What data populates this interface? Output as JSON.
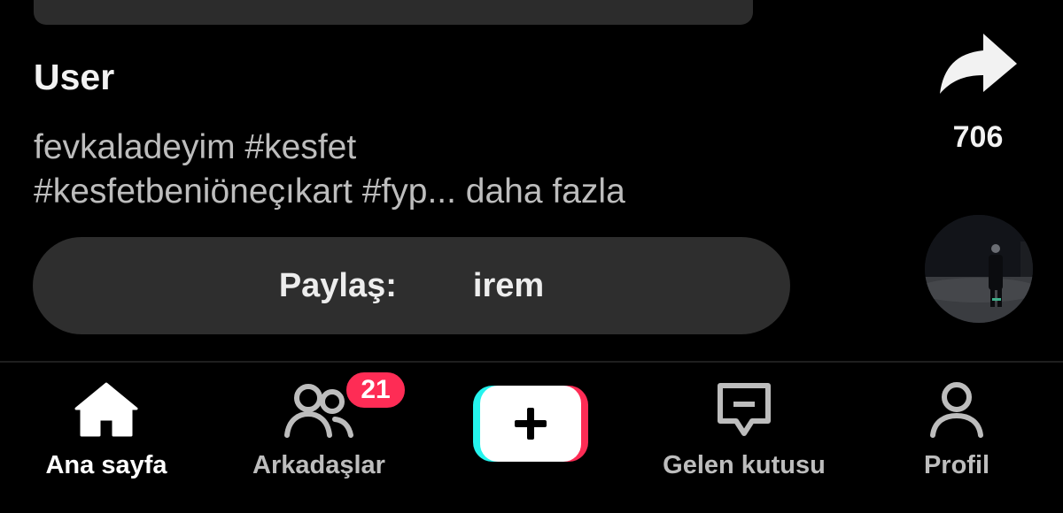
{
  "video": {
    "username": "User",
    "caption_line1": "fevkaladeyim #kesfet",
    "caption_line2": "#kesfetbeniöneçıkart #fyp...",
    "more_label": "daha fazla"
  },
  "share_bar": {
    "prefix": "Paylaş:",
    "name": "irem"
  },
  "actions": {
    "share_icon": "share-arrow-icon",
    "share_count": "706",
    "music_icon": "music-disc-avatar"
  },
  "nav": {
    "home_label": "Ana sayfa",
    "friends_label": "Arkadaşlar",
    "friends_badge": "21",
    "create_icon": "plus-icon",
    "inbox_label": "Gelen kutusu",
    "profile_label": "Profil"
  },
  "colors": {
    "background": "#000000",
    "badge": "#fe2c55",
    "create_cyan": "#25f4ee",
    "create_pink": "#fe2c55",
    "pill": "#2e2e2e"
  }
}
